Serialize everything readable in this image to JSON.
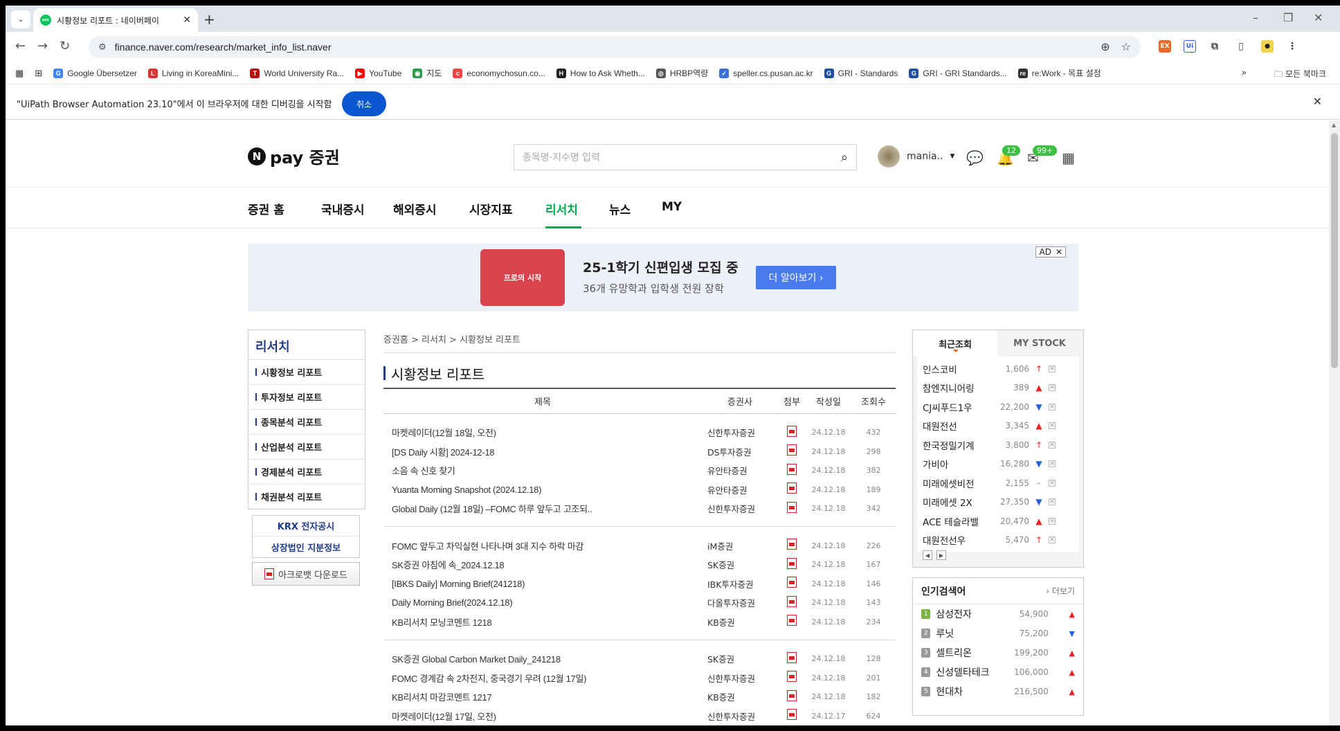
{
  "browser": {
    "tab_title": "시황정보 리포트 : 네이버페이",
    "url": "finance.naver.com/research/market_info_list.naver",
    "bookmarks": [
      {
        "label": "Google Übersetzer",
        "color": "#4285f4"
      },
      {
        "label": "Living in KoreaMini...",
        "color": "#d33"
      },
      {
        "label": "World University Ra...",
        "color": "#b11"
      },
      {
        "label": "YouTube",
        "color": "#f00"
      },
      {
        "label": "지도",
        "color": "#2a9d47"
      },
      {
        "label": "economychosun.co...",
        "color": "#e44"
      },
      {
        "label": "How to Ask Wheth...",
        "color": "#222"
      },
      {
        "label": "HRBP역량",
        "color": "#555"
      },
      {
        "label": "speller.cs.pusan.ac.kr",
        "color": "#3a6fd8"
      },
      {
        "label": "GRI - Standards",
        "color": "#1f4fa0"
      },
      {
        "label": "GRI - GRI Standards...",
        "color": "#1f4fa0"
      },
      {
        "label": "re:Work - 목표 설정",
        "color": "#333"
      }
    ],
    "all_bookmarks": "모든 북마크",
    "infobar_text": "\"UiPath Browser Automation 23.10\"에서 이 브라우저에 대한 디버깅을 시작함",
    "infobar_cancel": "취소"
  },
  "header": {
    "logo_text": "pay 증권",
    "search_placeholder": "종목명·지수명 입력",
    "user_name": "mania..",
    "alarm_count": "12",
    "mail_count": "99+"
  },
  "gnb": [
    "증권 홈",
    "국내증시",
    "해외증시",
    "시장지표",
    "리서치",
    "뉴스",
    "MY"
  ],
  "ad": {
    "image_text": "프로의 시작",
    "title": "25-1학기 신편입생 모집 중",
    "sub": "36개 유망학과 입학생 전원 장학",
    "button": "더 알아보기 ›",
    "mark": "AD"
  },
  "lnb": {
    "title": "리서치",
    "items": [
      "시황정보 리포트",
      "투자정보 리포트",
      "종목분석 리포트",
      "산업분석 리포트",
      "경제분석 리포트",
      "채권분석 리포트"
    ],
    "krx": "KRX 전자공시",
    "listed": "상장법인 지분정보",
    "acrobat": "아크로뱃 다운로드"
  },
  "main": {
    "breadcrumb": "증권홈 > 리서치 > 시황정보 리포트",
    "title": "시황정보 리포트",
    "columns": [
      "제목",
      "증권사",
      "첨부",
      "작성일",
      "조회수"
    ],
    "groups": [
      [
        {
          "title": "마켓레이더(12월 18일, 오전)",
          "broker": "신한투자증권",
          "date": "24.12.18",
          "views": "432"
        },
        {
          "title": "[DS Daily 시황] 2024-12-18",
          "broker": "DS투자증권",
          "date": "24.12.18",
          "views": "298"
        },
        {
          "title": "소음 속 신호 찾기",
          "broker": "유안타증권",
          "date": "24.12.18",
          "views": "382"
        },
        {
          "title": "Yuanta Morning Snapshot (2024.12.18)",
          "broker": "유안타증권",
          "date": "24.12.18",
          "views": "189"
        },
        {
          "title": "Global Daily (12월 18일) –FOMC 하루 앞두고 고조되..",
          "broker": "신한투자증권",
          "date": "24.12.18",
          "views": "342"
        }
      ],
      [
        {
          "title": "FOMC 앞두고 차익실현 나타나며 3대 지수 하락 마감",
          "broker": "iM증권",
          "date": "24.12.18",
          "views": "226"
        },
        {
          "title": "SK증권 아침에 속_2024.12.18",
          "broker": "SK증권",
          "date": "24.12.18",
          "views": "167"
        },
        {
          "title": "[IBKS Daily] Morning Brief(241218)",
          "broker": "IBK투자증권",
          "date": "24.12.18",
          "views": "146"
        },
        {
          "title": "Daily Morning Brief(2024.12.18)",
          "broker": "다올투자증권",
          "date": "24.12.18",
          "views": "143"
        },
        {
          "title": "KB리서치 모닝코멘트 1218",
          "broker": "KB증권",
          "date": "24.12.18",
          "views": "234"
        }
      ],
      [
        {
          "title": "SK증권 Global Carbon Market Daily_241218",
          "broker": "SK증권",
          "date": "24.12.18",
          "views": "128"
        },
        {
          "title": "FOMC 경계감 속 2차전지, 중국경기 우려 (12월 17일)",
          "broker": "신한투자증권",
          "date": "24.12.18",
          "views": "201"
        },
        {
          "title": "KB리서치 마감코멘트 1217",
          "broker": "KB증권",
          "date": "24.12.18",
          "views": "182"
        },
        {
          "title": "마켓레이더(12월 17일, 오전)",
          "broker": "신한투자증권",
          "date": "24.12.17",
          "views": "624"
        }
      ]
    ]
  },
  "recent": {
    "tab_recent": "최근조회",
    "tab_mystock": "MY STOCK",
    "items": [
      {
        "name": "인스코비",
        "value": "1,606",
        "dir": "up-big"
      },
      {
        "name": "참엔지니어링",
        "value": "389",
        "dir": "up"
      },
      {
        "name": "CJ씨푸드1우",
        "value": "22,200",
        "dir": "down"
      },
      {
        "name": "대원전선",
        "value": "3,345",
        "dir": "up"
      },
      {
        "name": "한국정밀기계",
        "value": "3,800",
        "dir": "up-big"
      },
      {
        "name": "가비아",
        "value": "16,280",
        "dir": "down"
      },
      {
        "name": "미래에셋비전",
        "value": "2,155",
        "dir": "flat"
      },
      {
        "name": "미래에셋 2X",
        "value": "27,350",
        "dir": "down"
      },
      {
        "name": "ACE 테슬라밸",
        "value": "20,470",
        "dir": "up"
      },
      {
        "name": "대원전선우",
        "value": "5,470",
        "dir": "up-big"
      }
    ]
  },
  "popular": {
    "title": "인기검색어",
    "more": "더보기",
    "items": [
      {
        "rank": "1",
        "name": "삼성전자",
        "value": "54,900",
        "dir": "up"
      },
      {
        "rank": "2",
        "name": "루닛",
        "value": "75,200",
        "dir": "down"
      },
      {
        "rank": "3",
        "name": "셀트리온",
        "value": "199,200",
        "dir": "up"
      },
      {
        "rank": "4",
        "name": "신성델타테크",
        "value": "106,000",
        "dir": "up"
      },
      {
        "rank": "5",
        "name": "현대차",
        "value": "216,500",
        "dir": "up"
      }
    ]
  }
}
